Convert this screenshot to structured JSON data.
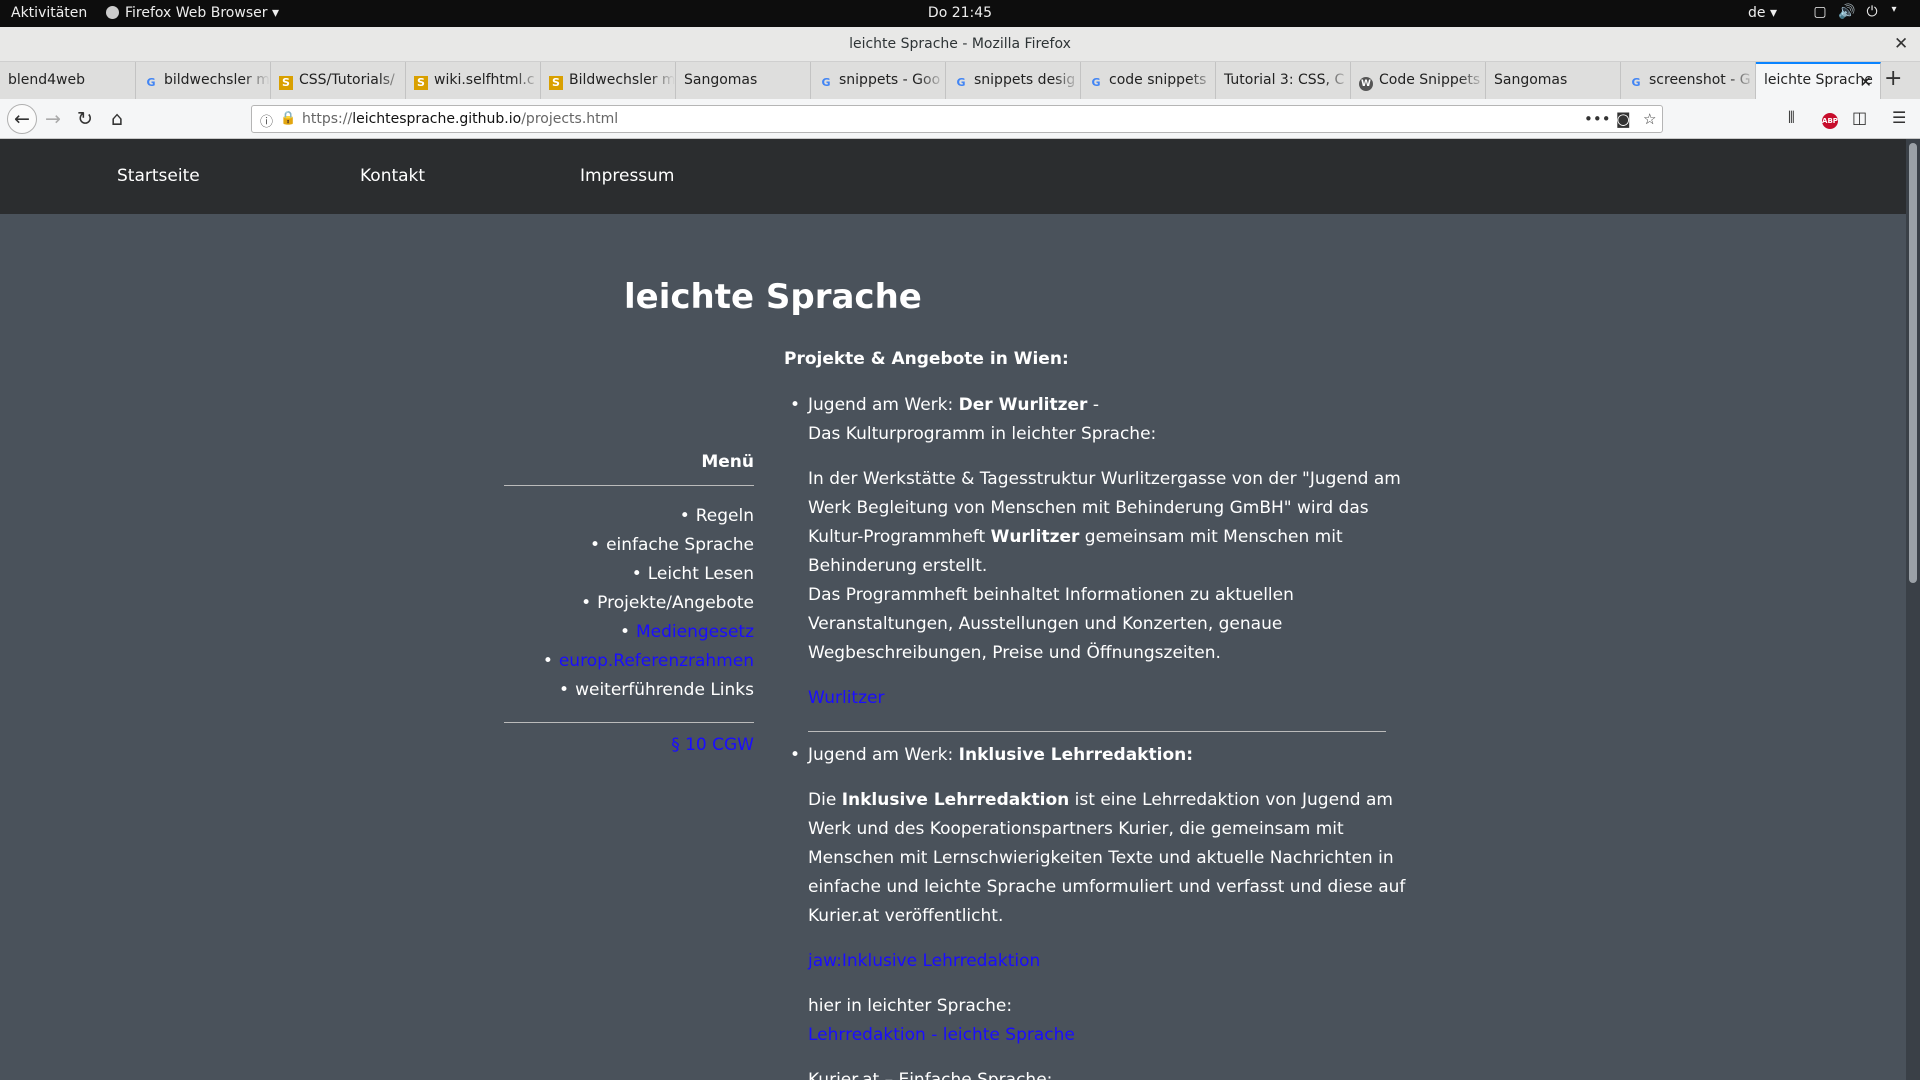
{
  "gnome": {
    "activities": "Aktivitäten",
    "app_menu": "Firefox Web Browser ▾",
    "clock": "Do 21:45",
    "lang": "de ▾"
  },
  "window": {
    "title": "leichte Sprache - Mozilla Firefox"
  },
  "tabs": [
    {
      "label": "blend4web",
      "favicon": "none"
    },
    {
      "label": "bildwechsler m",
      "favicon": "google"
    },
    {
      "label": "CSS/Tutorials/",
      "favicon": "selfhtml"
    },
    {
      "label": "wiki.selfhtml.c",
      "favicon": "selfhtml"
    },
    {
      "label": "Bildwechsler m",
      "favicon": "selfhtml"
    },
    {
      "label": "Sangomas",
      "favicon": "none"
    },
    {
      "label": "snippets - Goo",
      "favicon": "google"
    },
    {
      "label": "snippets desig",
      "favicon": "google"
    },
    {
      "label": "code snippets",
      "favicon": "google"
    },
    {
      "label": "Tutorial 3: CSS, C",
      "favicon": "none"
    },
    {
      "label": "Code Snippets",
      "favicon": "wordpress"
    },
    {
      "label": "Sangomas",
      "favicon": "none"
    },
    {
      "label": "screenshot - G",
      "favicon": "google"
    },
    {
      "label": "leichte Sprache",
      "favicon": "none",
      "active": true
    }
  ],
  "urlbar": {
    "scheme": "https://",
    "host": "leichtesprache.github.io",
    "path": "/projects.html"
  },
  "site_nav": {
    "home": "Startseite",
    "contact": "Kontakt",
    "imprint": "Impressum"
  },
  "page": {
    "title": "leichte Sprache",
    "section_title": "Projekte & Angebote in Wien:"
  },
  "menu": {
    "heading": "Menü",
    "items": [
      {
        "label": "Regeln",
        "is_link": false
      },
      {
        "label": "einfache Sprache",
        "is_link": false
      },
      {
        "label": "Leicht Lesen",
        "is_link": false
      },
      {
        "label": "Projekte/Angebote",
        "is_link": false
      },
      {
        "label": "Mediengesetz",
        "is_link": true
      },
      {
        "label": "europ.Referenzrahmen",
        "is_link": true
      },
      {
        "label": "weiterführende Links",
        "is_link": false
      }
    ],
    "cgw_link": "§ 10 CGW"
  },
  "projects": {
    "p1": {
      "org": "Jugend am Werk: ",
      "name": "Der Wurlitzer",
      "dash": " -",
      "subtitle": "Das Kulturprogramm in leichter Sprache:",
      "desc_part1": "In der Werkstätte & Tagesstruktur Wurlitzergasse von der \"Jugend am Werk Begleitung von Menschen mit Behinderung GmBH\" wird das Kultur-Programmheft ",
      "desc_bold": "Wurlitzer",
      "desc_part2": " gemeinsam mit Menschen mit Behinderung erstellt.",
      "desc2": "Das Programmheft beinhaltet Informationen zu aktuellen Veranstaltungen, Ausstellungen und Konzerten, genaue Wegbeschreibungen, Preise und Öffnungszeiten.",
      "link": "Wurlitzer"
    },
    "p2": {
      "org": "Jugend am Werk: ",
      "name": "Inklusive Lehrredaktion:",
      "desc_intro": "Die ",
      "desc_bold": "Inklusive Lehrredaktion",
      "desc_rest": " ist eine Lehrredaktion von Jugend am Werk und des Kooperationspartners Kurier, die gemeinsam mit Menschen mit Lernschwierigkeiten Texte und aktuelle Nachrichten in einfache und leichte Sprache umformuliert und verfasst und diese auf Kurier.at veröffentlicht.",
      "link": "jaw:Inklusive Lehrredaktion",
      "easy_label": "hier in leichter Sprache:",
      "easy_link": "Lehrredaktion - leichte Sprache",
      "cutoff": "Kurier.at – Einfache Sprache:"
    }
  }
}
